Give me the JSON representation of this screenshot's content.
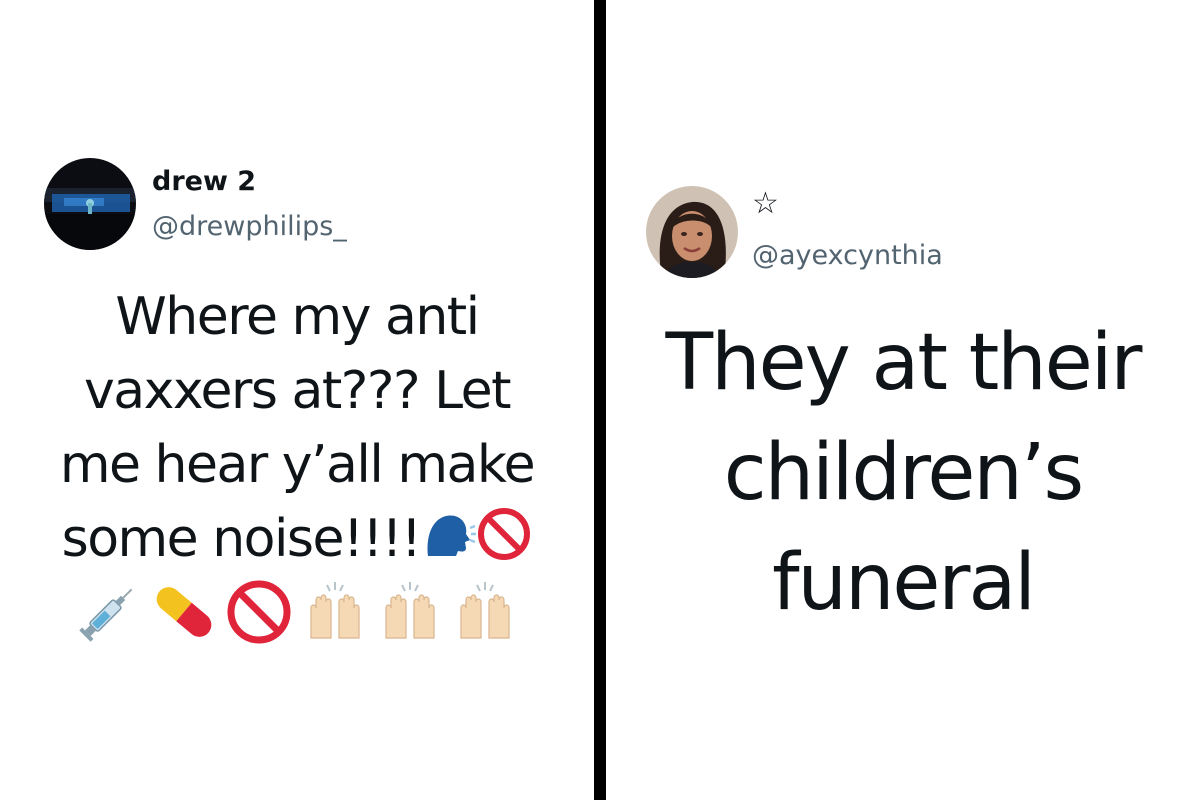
{
  "left_tweet": {
    "display_name": "drew 2",
    "handle": "@drewphilips_",
    "avatar": "avatar-photo-dark-night-scene",
    "text_lines": [
      "Where my anti",
      "vaxxers at??? Let",
      "me hear y’all make",
      "some noise!!!!"
    ],
    "inline_emojis": [
      "speaking-head-icon",
      "prohibited-icon"
    ],
    "emoji_row": [
      "syringe-icon",
      "pill-icon",
      "prohibited-icon",
      "raising-hands-icon",
      "raising-hands-icon",
      "raising-hands-icon"
    ]
  },
  "right_tweet": {
    "display_name": "☆",
    "handle": "@ayexcynthia",
    "avatar": "avatar-photo-woman",
    "text_lines": [
      "They at their",
      "children’s",
      "funeral"
    ]
  },
  "colors": {
    "text": "#0f1419",
    "handle": "#536471",
    "divider": "#000000",
    "background": "#ffffff"
  }
}
